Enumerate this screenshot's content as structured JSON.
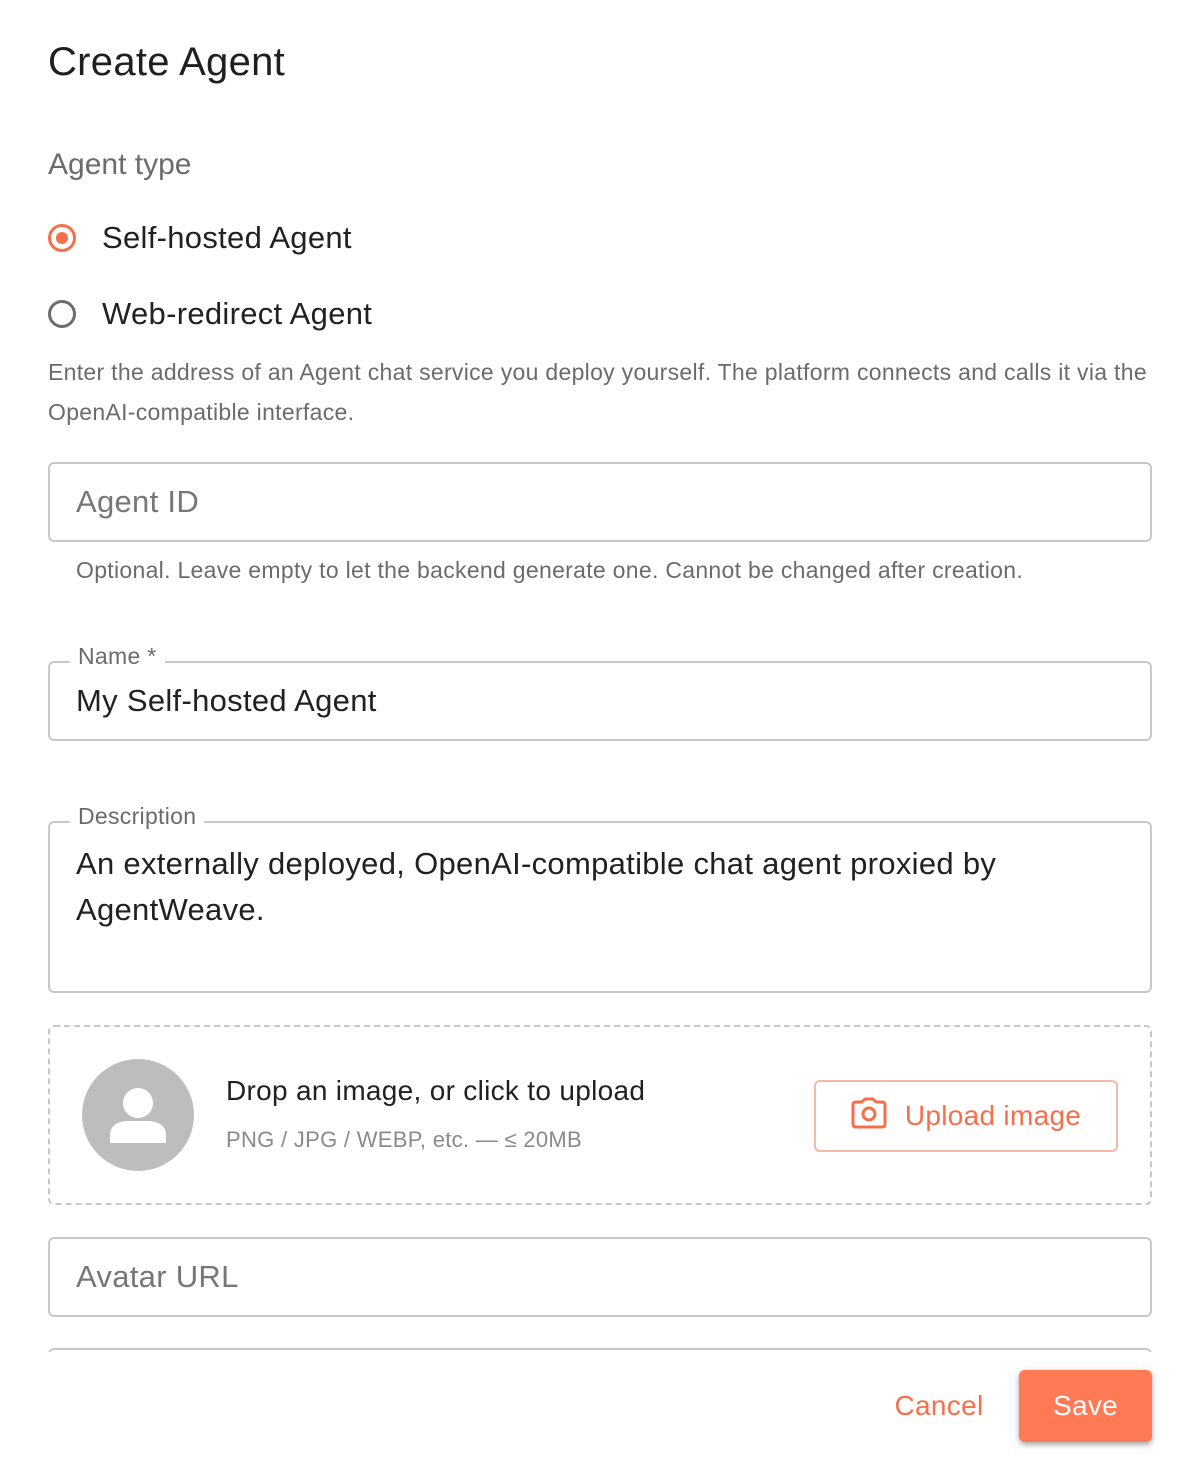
{
  "dialog": {
    "title": "Create Agent"
  },
  "agent_type": {
    "label": "Agent type",
    "options": [
      {
        "label": "Self-hosted Agent",
        "selected": true
      },
      {
        "label": "Web-redirect Agent",
        "selected": false
      }
    ],
    "description": "Enter the address of an Agent chat service you deploy yourself. The platform connects and calls it via the OpenAI-compatible interface."
  },
  "fields": {
    "agent_id": {
      "placeholder": "Agent ID",
      "value": "",
      "help": "Optional. Leave empty to let the backend generate one. Cannot be changed after creation."
    },
    "name": {
      "label": "Name *",
      "value": "My Self-hosted Agent"
    },
    "description": {
      "label": "Description",
      "value": "An externally deployed, OpenAI-compatible chat agent proxied by AgentWeave."
    },
    "avatar_url": {
      "placeholder": "Avatar URL",
      "value": ""
    }
  },
  "upload": {
    "title": "Drop an image, or click to upload",
    "subtitle": "PNG / JPG / WEBP, etc. — ≤ 20MB",
    "button_label": "Upload image",
    "button_icon": "camera-icon",
    "avatar_icon": "person-icon"
  },
  "actions": {
    "cancel_label": "Cancel",
    "save_label": "Save"
  },
  "colors": {
    "accent": "#f5704a",
    "save_bg": "#ff7a55",
    "avatar_bg": "#bdbdbd",
    "border": "#c8c8c8"
  }
}
